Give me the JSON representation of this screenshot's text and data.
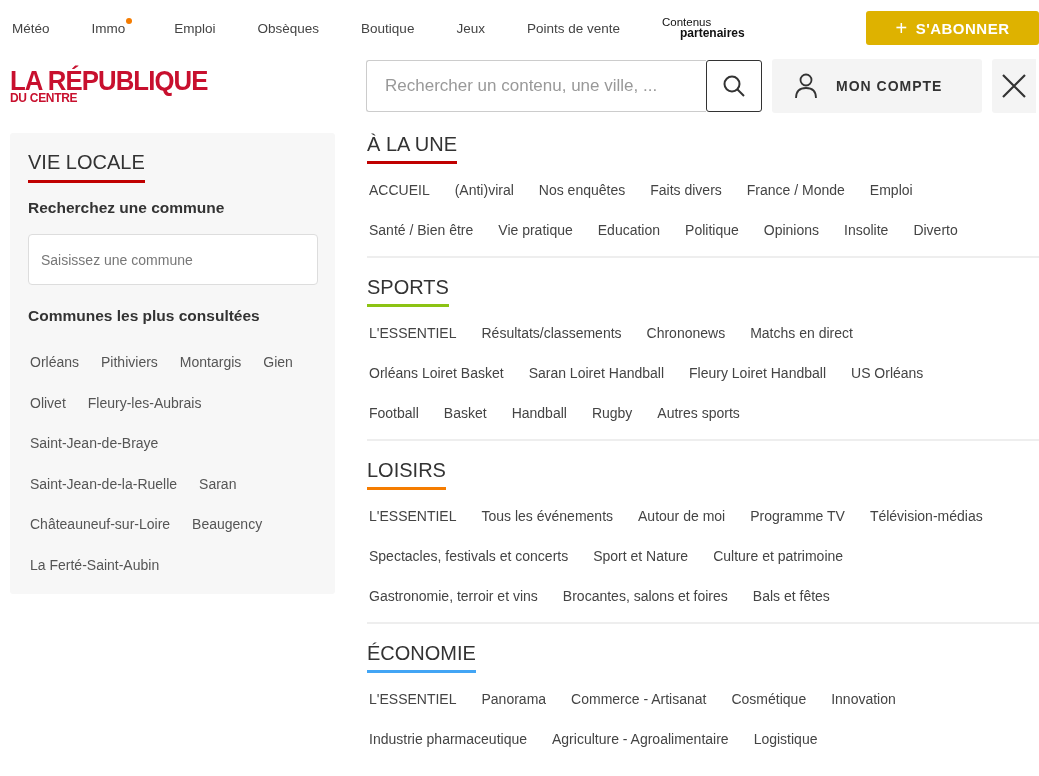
{
  "top_nav": [
    {
      "label": "Météo",
      "dot": false
    },
    {
      "label": "Immo",
      "dot": true
    },
    {
      "label": "Emploi",
      "dot": false
    },
    {
      "label": "Obsèques",
      "dot": false
    },
    {
      "label": "Boutique",
      "dot": false
    },
    {
      "label": "Jeux",
      "dot": false
    },
    {
      "label": "Points de vente",
      "dot": false
    }
  ],
  "partners": {
    "top": "Contenus",
    "bottom": "partenaires"
  },
  "subscribe_button": {
    "icon": "+",
    "label": "S'ABONNER"
  },
  "logo": {
    "title": "LA RÉPUBLIQUE",
    "subtitle": "DU CENTRE"
  },
  "search": {
    "placeholder": "Rechercher un contenu, une ville, ..."
  },
  "account_button": {
    "label": "MON COMPTE"
  },
  "sidebar": {
    "title": "VIE LOCALE",
    "search_heading": "Recherchez une commune",
    "search_placeholder": "Saisissez une commune",
    "popular_heading": "Communes les plus consultées",
    "rows": [
      [
        "Orléans",
        "Pithiviers",
        "Montargis",
        "Gien"
      ],
      [
        "Olivet",
        "Fleury-les-Aubrais"
      ],
      [
        "Saint-Jean-de-Braye"
      ],
      [
        "Saint-Jean-de-la-Ruelle",
        "Saran"
      ],
      [
        "Châteauneuf-sur-Loire",
        "Beaugency"
      ],
      [
        "La Ferté-Saint-Aubin"
      ]
    ]
  },
  "sections": [
    {
      "title": "À LA UNE",
      "color": "#c00000",
      "lines": [
        {
          "links": [
            "ACCUEIL",
            "(Anti)viral",
            "Nos enquêtes",
            "Faits divers",
            "France / Monde",
            "Emploi"
          ]
        },
        {
          "links": [
            "Santé / Bien être",
            "Vie pratique",
            "Education",
            "Politique",
            "Opinions",
            "Insolite",
            "Diverto"
          ]
        }
      ]
    },
    {
      "title": "SPORTS",
      "color": "#8cc313",
      "lines": [
        {
          "links": [
            "L'ESSENTIEL",
            "Résultats/classements",
            "Chrononews",
            "Matchs en direct"
          ]
        },
        {
          "links": [
            "Orléans Loiret Basket",
            "Saran Loiret Handball",
            "Fleury Loiret Handball",
            "US Orléans"
          ]
        },
        {
          "links": [
            "Football",
            "Basket",
            "Handball",
            "Rugby",
            "Autres sports"
          ]
        }
      ]
    },
    {
      "title": "LOISIRS",
      "color": "#f57c00",
      "lines": [
        {
          "links": [
            "L'ESSENTIEL",
            "Tous les événements",
            "Autour de moi",
            "Programme TV",
            "Télévision-médias"
          ]
        },
        {
          "links": [
            "Spectacles, festivals et concerts",
            "Sport et Nature",
            "Culture et patrimoine"
          ]
        },
        {
          "links": [
            "Gastronomie, terroir et vins",
            "Brocantes, salons et foires",
            "Bals et fêtes"
          ]
        }
      ]
    },
    {
      "title": "ÉCONOMIE",
      "color": "#42a5f5",
      "lines": [
        {
          "links": [
            "L'ESSENTIEL",
            "Panorama",
            "Commerce - Artisanat",
            "Cosmétique",
            "Innovation"
          ]
        },
        {
          "links": [
            "Industrie pharmaceutique",
            "Agriculture - Agroalimentaire",
            "Logistique"
          ]
        }
      ]
    }
  ]
}
